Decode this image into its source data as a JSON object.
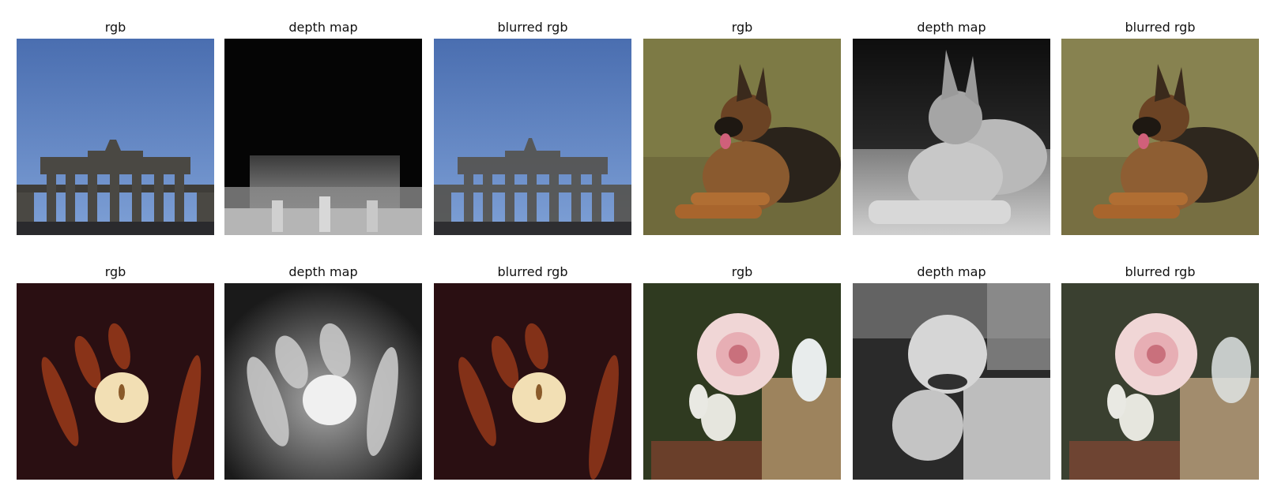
{
  "figure": {
    "rows": [
      {
        "panels": [
          {
            "title": "rgb",
            "scene": "brandenburg-gate-photo"
          },
          {
            "title": "depth map",
            "scene": "brandenburg-gate-depth"
          },
          {
            "title": "blurred rgb",
            "scene": "brandenburg-gate-blurred"
          },
          {
            "title": "rgb",
            "scene": "german-shepherd-photo"
          },
          {
            "title": "depth map",
            "scene": "german-shepherd-depth"
          },
          {
            "title": "blurred rgb",
            "scene": "german-shepherd-blurred"
          }
        ]
      },
      {
        "panels": [
          {
            "title": "rgb",
            "scene": "candle-hands-photo"
          },
          {
            "title": "depth map",
            "scene": "candle-hands-depth"
          },
          {
            "title": "blurred rgb",
            "scene": "candle-hands-blurred"
          },
          {
            "title": "rgb",
            "scene": "rose-photo"
          },
          {
            "title": "depth map",
            "scene": "rose-depth"
          },
          {
            "title": "blurred rgb",
            "scene": "rose-blurred"
          }
        ]
      }
    ]
  }
}
